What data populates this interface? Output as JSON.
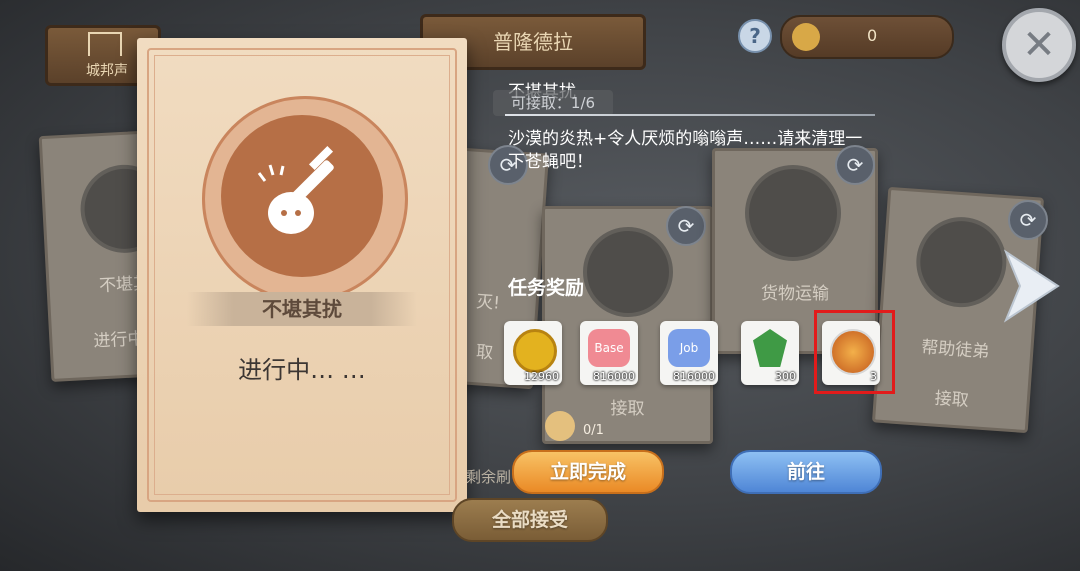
{
  "top": {
    "city_label": "城邦声",
    "location": "普隆德拉",
    "coin_count": "0"
  },
  "main_card": {
    "title": "不堪其扰",
    "status": "进行中… …"
  },
  "background_cards": [
    {
      "title": "不堪其",
      "status": "进行中…"
    },
    {
      "title": "灭!",
      "status": "取"
    },
    {
      "title": "",
      "status": "接取"
    },
    {
      "title": "货物运输",
      "status": ""
    },
    {
      "title": "帮助徒弟",
      "status": "接取"
    }
  ],
  "quest": {
    "name": "不堪其扰",
    "accept_count": "可接取：1/6",
    "description": "沙漠的炎热+令人厌烦的嗡嗡声……请来清理一下苍蝇吧！",
    "rewards_heading": "任务奖励",
    "rewards": [
      {
        "icon": "zeny-coin-icon",
        "count": "12960"
      },
      {
        "icon": "base-exp-icon",
        "count": "816000"
      },
      {
        "icon": "job-exp-icon",
        "count": "816000"
      },
      {
        "icon": "green-crest-icon",
        "count": "300"
      },
      {
        "icon": "guild-badge-icon",
        "count": "3"
      }
    ],
    "item_progress": "0/1"
  },
  "buttons": {
    "complete_now": "立即完成",
    "go_to": "前往",
    "accept_all": "全部接受",
    "refresh_remaining": "剩余刷"
  },
  "colors": {
    "complete_button": "#f4a53f",
    "go_button": "#5f9ee8",
    "highlight_box": "#e21b1b"
  }
}
